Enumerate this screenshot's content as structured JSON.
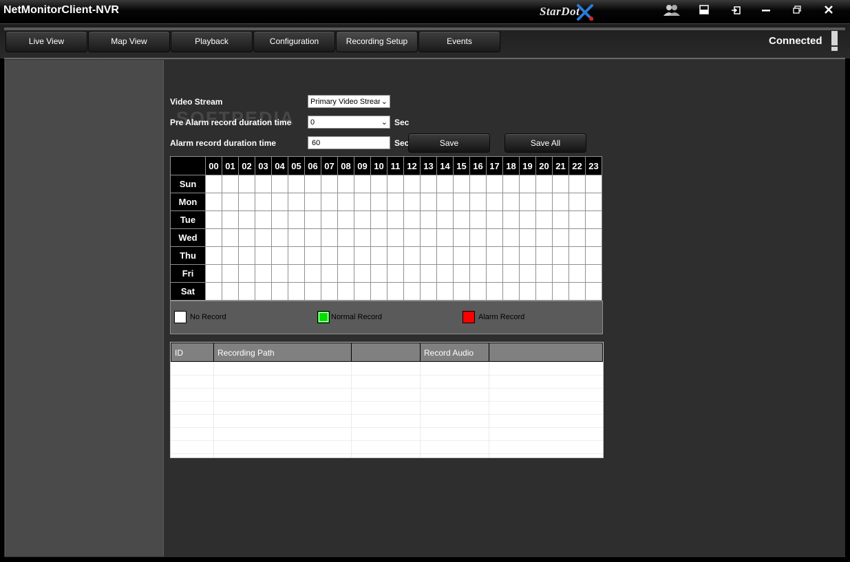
{
  "app": {
    "title": "NetMonitorClient-NVR",
    "logo_text": "StarDot"
  },
  "window_controls": {
    "users": "👥",
    "layout": "▬",
    "logout": "⇥",
    "minimize": "—",
    "restore": "⧉",
    "close": "✕"
  },
  "tabs": [
    "Live View",
    "Map View",
    "Playback",
    "Configuration",
    "Recording Setup",
    "Events"
  ],
  "active_tab": "Recording Setup",
  "status": {
    "text": "Connected"
  },
  "watermark": "SOFTPEDIA",
  "form": {
    "video_stream_label": "Video Stream",
    "video_stream_value": "Primary Video Strear",
    "pre_alarm_label": "Pre Alarm record duration time",
    "pre_alarm_value": "0",
    "pre_alarm_unit": "Sec",
    "alarm_label": "Alarm record duration time",
    "alarm_value": "60",
    "alarm_unit": "Sec",
    "save_label": "Save",
    "save_all_label": "Save All"
  },
  "schedule": {
    "hours": [
      "00",
      "01",
      "02",
      "03",
      "04",
      "05",
      "06",
      "07",
      "08",
      "09",
      "10",
      "11",
      "12",
      "13",
      "14",
      "15",
      "16",
      "17",
      "18",
      "19",
      "20",
      "21",
      "22",
      "23"
    ],
    "days": [
      "Sun",
      "Mon",
      "Tue",
      "Wed",
      "Thu",
      "Fri",
      "Sat"
    ]
  },
  "legend": {
    "no_record": "No Record",
    "no_record_color": "#ffffff",
    "normal_record": "Normal Record",
    "normal_record_color": "#00e000",
    "alarm_record": "Alarm Record",
    "alarm_record_color": "#ff0000"
  },
  "recording_table": {
    "columns": [
      "ID",
      "Recording Path",
      "",
      "Record Audio",
      ""
    ]
  }
}
